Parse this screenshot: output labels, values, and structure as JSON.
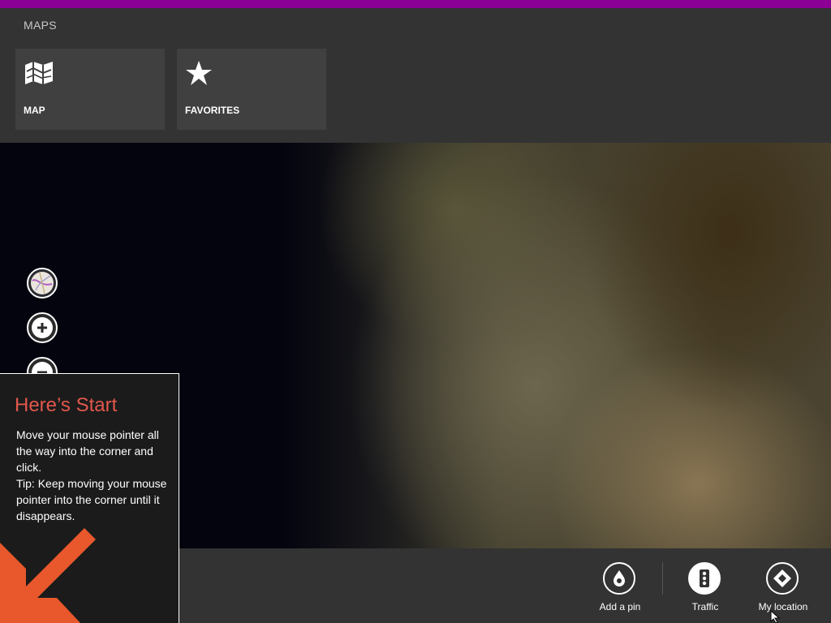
{
  "colors": {
    "accent": "#8c0096",
    "appbar": "#333333",
    "tile": "#404040",
    "tip_title": "#e2574c",
    "tip_arrow": "#e8582c"
  },
  "nav": {
    "title": "MAPS",
    "tiles": [
      {
        "label": "MAP",
        "icon": "map-icon"
      },
      {
        "label": "FAVORITES",
        "icon": "star-icon"
      }
    ]
  },
  "map_controls": [
    {
      "name": "map-style-icon"
    },
    {
      "name": "zoom-in-icon"
    },
    {
      "name": "zoom-out-icon"
    }
  ],
  "commands": [
    {
      "label": "Add a pin",
      "icon": "pin-icon"
    },
    {
      "label": "Traffic",
      "icon": "traffic-light-icon"
    },
    {
      "label": "My location",
      "icon": "location-icon"
    }
  ],
  "start_tip": {
    "title": "Here’s Start",
    "body": "Move your mouse pointer all the way into the corner and click.",
    "tip": "Tip: Keep moving your mouse pointer into the corner until it disappears."
  }
}
